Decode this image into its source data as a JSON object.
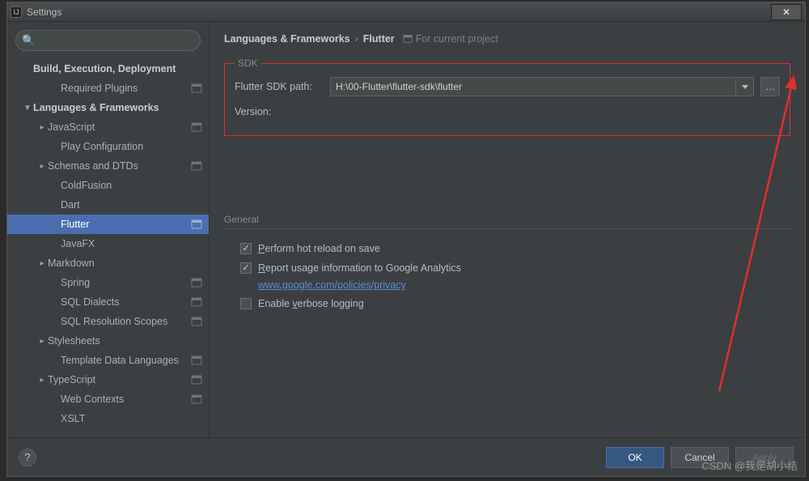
{
  "window": {
    "title": "Settings"
  },
  "search": {
    "placeholder": ""
  },
  "sidebar": {
    "groups": {
      "build": "Build, Execution, Deployment",
      "required_plugins": "Required Plugins",
      "lang": "Languages & Frameworks",
      "javascript": "JavaScript",
      "play": "Play Configuration",
      "schemas": "Schemas and DTDs",
      "coldfusion": "ColdFusion",
      "dart": "Dart",
      "flutter": "Flutter",
      "javafx": "JavaFX",
      "markdown": "Markdown",
      "spring": "Spring",
      "sql_dialects": "SQL Dialects",
      "sql_resolution": "SQL Resolution Scopes",
      "stylesheets": "Stylesheets",
      "template_langs": "Template Data Languages",
      "typescript": "TypeScript",
      "web_contexts": "Web Contexts",
      "xslt": "XSLT"
    }
  },
  "breadcrumb": {
    "a": "Languages & Frameworks",
    "b": "Flutter",
    "hint": "For current project"
  },
  "sdk": {
    "legend": "SDK",
    "path_label": "Flutter SDK path:",
    "path_value": "H:\\00-Flutter\\flutter-sdk\\flutter",
    "version_label": "Version:"
  },
  "general": {
    "legend": "General",
    "hot_reload": "Perform hot reload on save",
    "analytics": "Report usage information to Google Analytics",
    "analytics_link": "www.google.com/policies/privacy",
    "verbose": "Enable verbose logging"
  },
  "buttons": {
    "ok": "OK",
    "cancel": "Cancel",
    "apply": "Apply"
  },
  "watermark": "CSDN @我是胡小结"
}
